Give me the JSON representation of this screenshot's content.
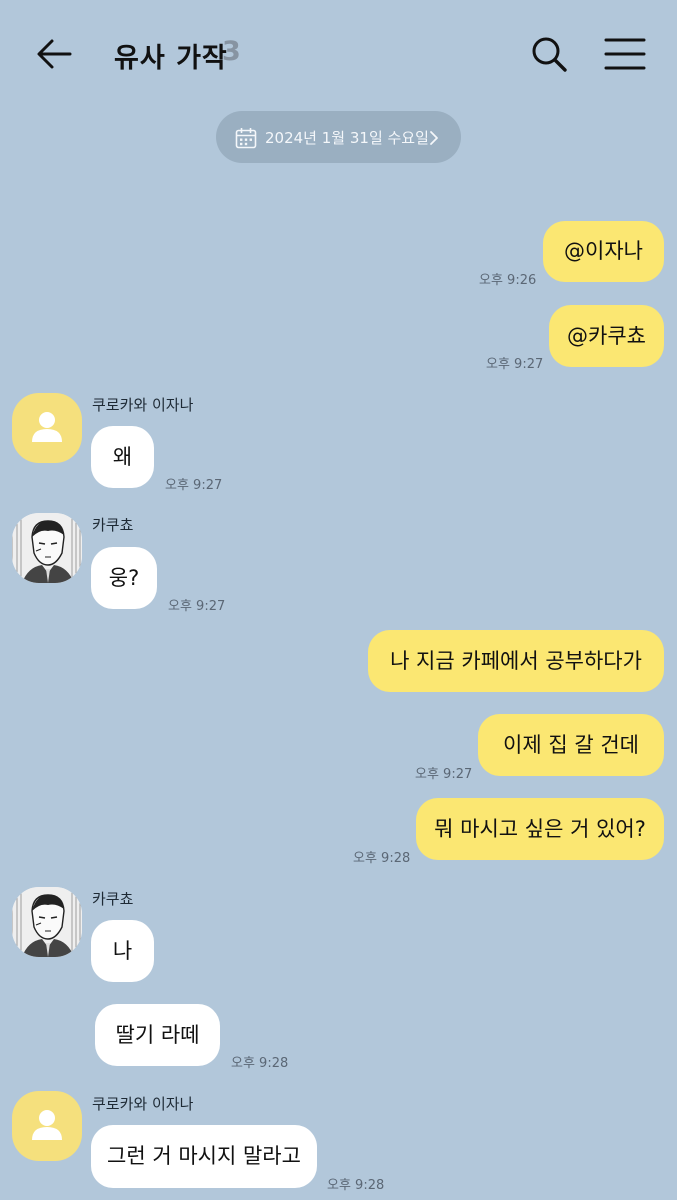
{
  "header": {
    "title": "유사 가작",
    "member_count": "3",
    "icons": {
      "back": "arrow-left-icon",
      "search": "search-icon",
      "menu": "hamburger-menu-icon"
    }
  },
  "date_divider": {
    "text": "2024년 1월 31일 수요일",
    "icon": "calendar-icon",
    "chevron": "chevron-right-icon"
  },
  "colors": {
    "background": "#b2c7da",
    "my_bubble": "#fbe772",
    "other_bubble": "#ffffff",
    "date_pill": "#9aafc1",
    "default_avatar": "#f5e07d"
  },
  "messages": [
    {
      "side": "me",
      "text": "@이자나",
      "time": "오후 9:26"
    },
    {
      "side": "me",
      "text": "@카쿠쵸",
      "time": "오후 9:27"
    },
    {
      "side": "other",
      "sender": "쿠로카와 이자나",
      "text": "왜",
      "time": "오후 9:27"
    },
    {
      "side": "other",
      "sender": "카쿠쵸",
      "text": "웅?",
      "time": "오후 9:27"
    },
    {
      "side": "me",
      "text": "나 지금 카페에서 공부하다가"
    },
    {
      "side": "me",
      "text": "이제 집 갈 건데",
      "time": "오후 9:27"
    },
    {
      "side": "me",
      "text": "뭐 마시고 싶은 거 있어?",
      "time": "오후 9:28"
    },
    {
      "side": "other",
      "sender": "카쿠쵸",
      "text": "나"
    },
    {
      "side": "other",
      "text": "딸기 라떼",
      "time": "오후 9:28"
    },
    {
      "side": "other",
      "sender": "쿠로카와 이자나",
      "text": "그런 거 마시지 말라고",
      "time": "오후 9:28"
    }
  ]
}
